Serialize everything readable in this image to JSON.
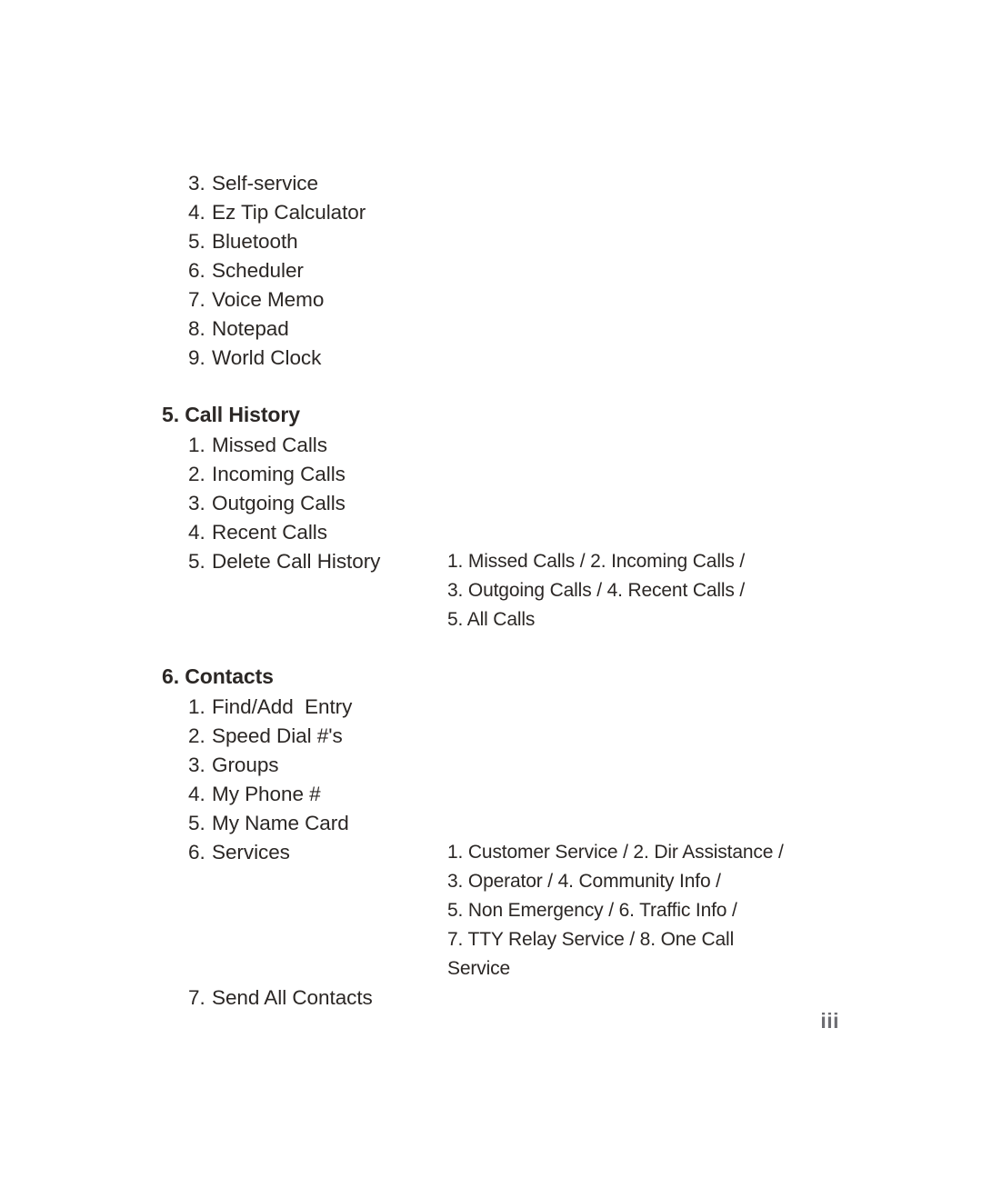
{
  "page": {
    "folio": "iii"
  },
  "sections": [
    {
      "id": "continued-list",
      "heading": null,
      "items": [
        {
          "num": "3.",
          "label": "Self-service",
          "detail": null
        },
        {
          "num": "4.",
          "label": "Ez Tip Calculator",
          "detail": null
        },
        {
          "num": "5.",
          "label": "Bluetooth",
          "detail": null
        },
        {
          "num": "6.",
          "label": "Scheduler",
          "detail": null
        },
        {
          "num": "7.",
          "label": "Voice Memo",
          "detail": null
        },
        {
          "num": "8.",
          "label": "Notepad",
          "detail": null
        },
        {
          "num": "9.",
          "label": "World Clock",
          "detail": null
        }
      ]
    },
    {
      "id": "call-history",
      "heading": "5. Call History",
      "items": [
        {
          "num": "1.",
          "label": "Missed Calls",
          "detail": null
        },
        {
          "num": "2.",
          "label": "Incoming Calls",
          "detail": null
        },
        {
          "num": "3.",
          "label": "Outgoing Calls",
          "detail": null
        },
        {
          "num": "4.",
          "label": "Recent Calls",
          "detail": null
        },
        {
          "num": "5.",
          "label": "Delete Call History",
          "detail": "1. Missed Calls / 2. Incoming Calls /\n3. Outgoing Calls / 4. Recent Calls /\n5. All Calls",
          "detail_lines": 3
        }
      ]
    },
    {
      "id": "contacts",
      "heading": "6. Contacts",
      "items": [
        {
          "num": "1.",
          "label": "Find/Add  Entry",
          "detail": null
        },
        {
          "num": "2.",
          "label": "Speed Dial #'s",
          "detail": null
        },
        {
          "num": "3.",
          "label": "Groups",
          "detail": null
        },
        {
          "num": "4.",
          "label": "My Phone #",
          "detail": null
        },
        {
          "num": "5.",
          "label": "My Name Card",
          "detail": null
        },
        {
          "num": "6.",
          "label": "Services",
          "detail": "1. Customer Service / 2. Dir Assistance /\n3. Operator / 4. Community Info /\n5. Non Emergency / 6. Traffic Info /\n7. TTY Relay Service / 8. One Call\nService",
          "detail_lines": 5
        },
        {
          "num": "7.",
          "label": "Send All Contacts",
          "detail": null
        }
      ]
    }
  ]
}
